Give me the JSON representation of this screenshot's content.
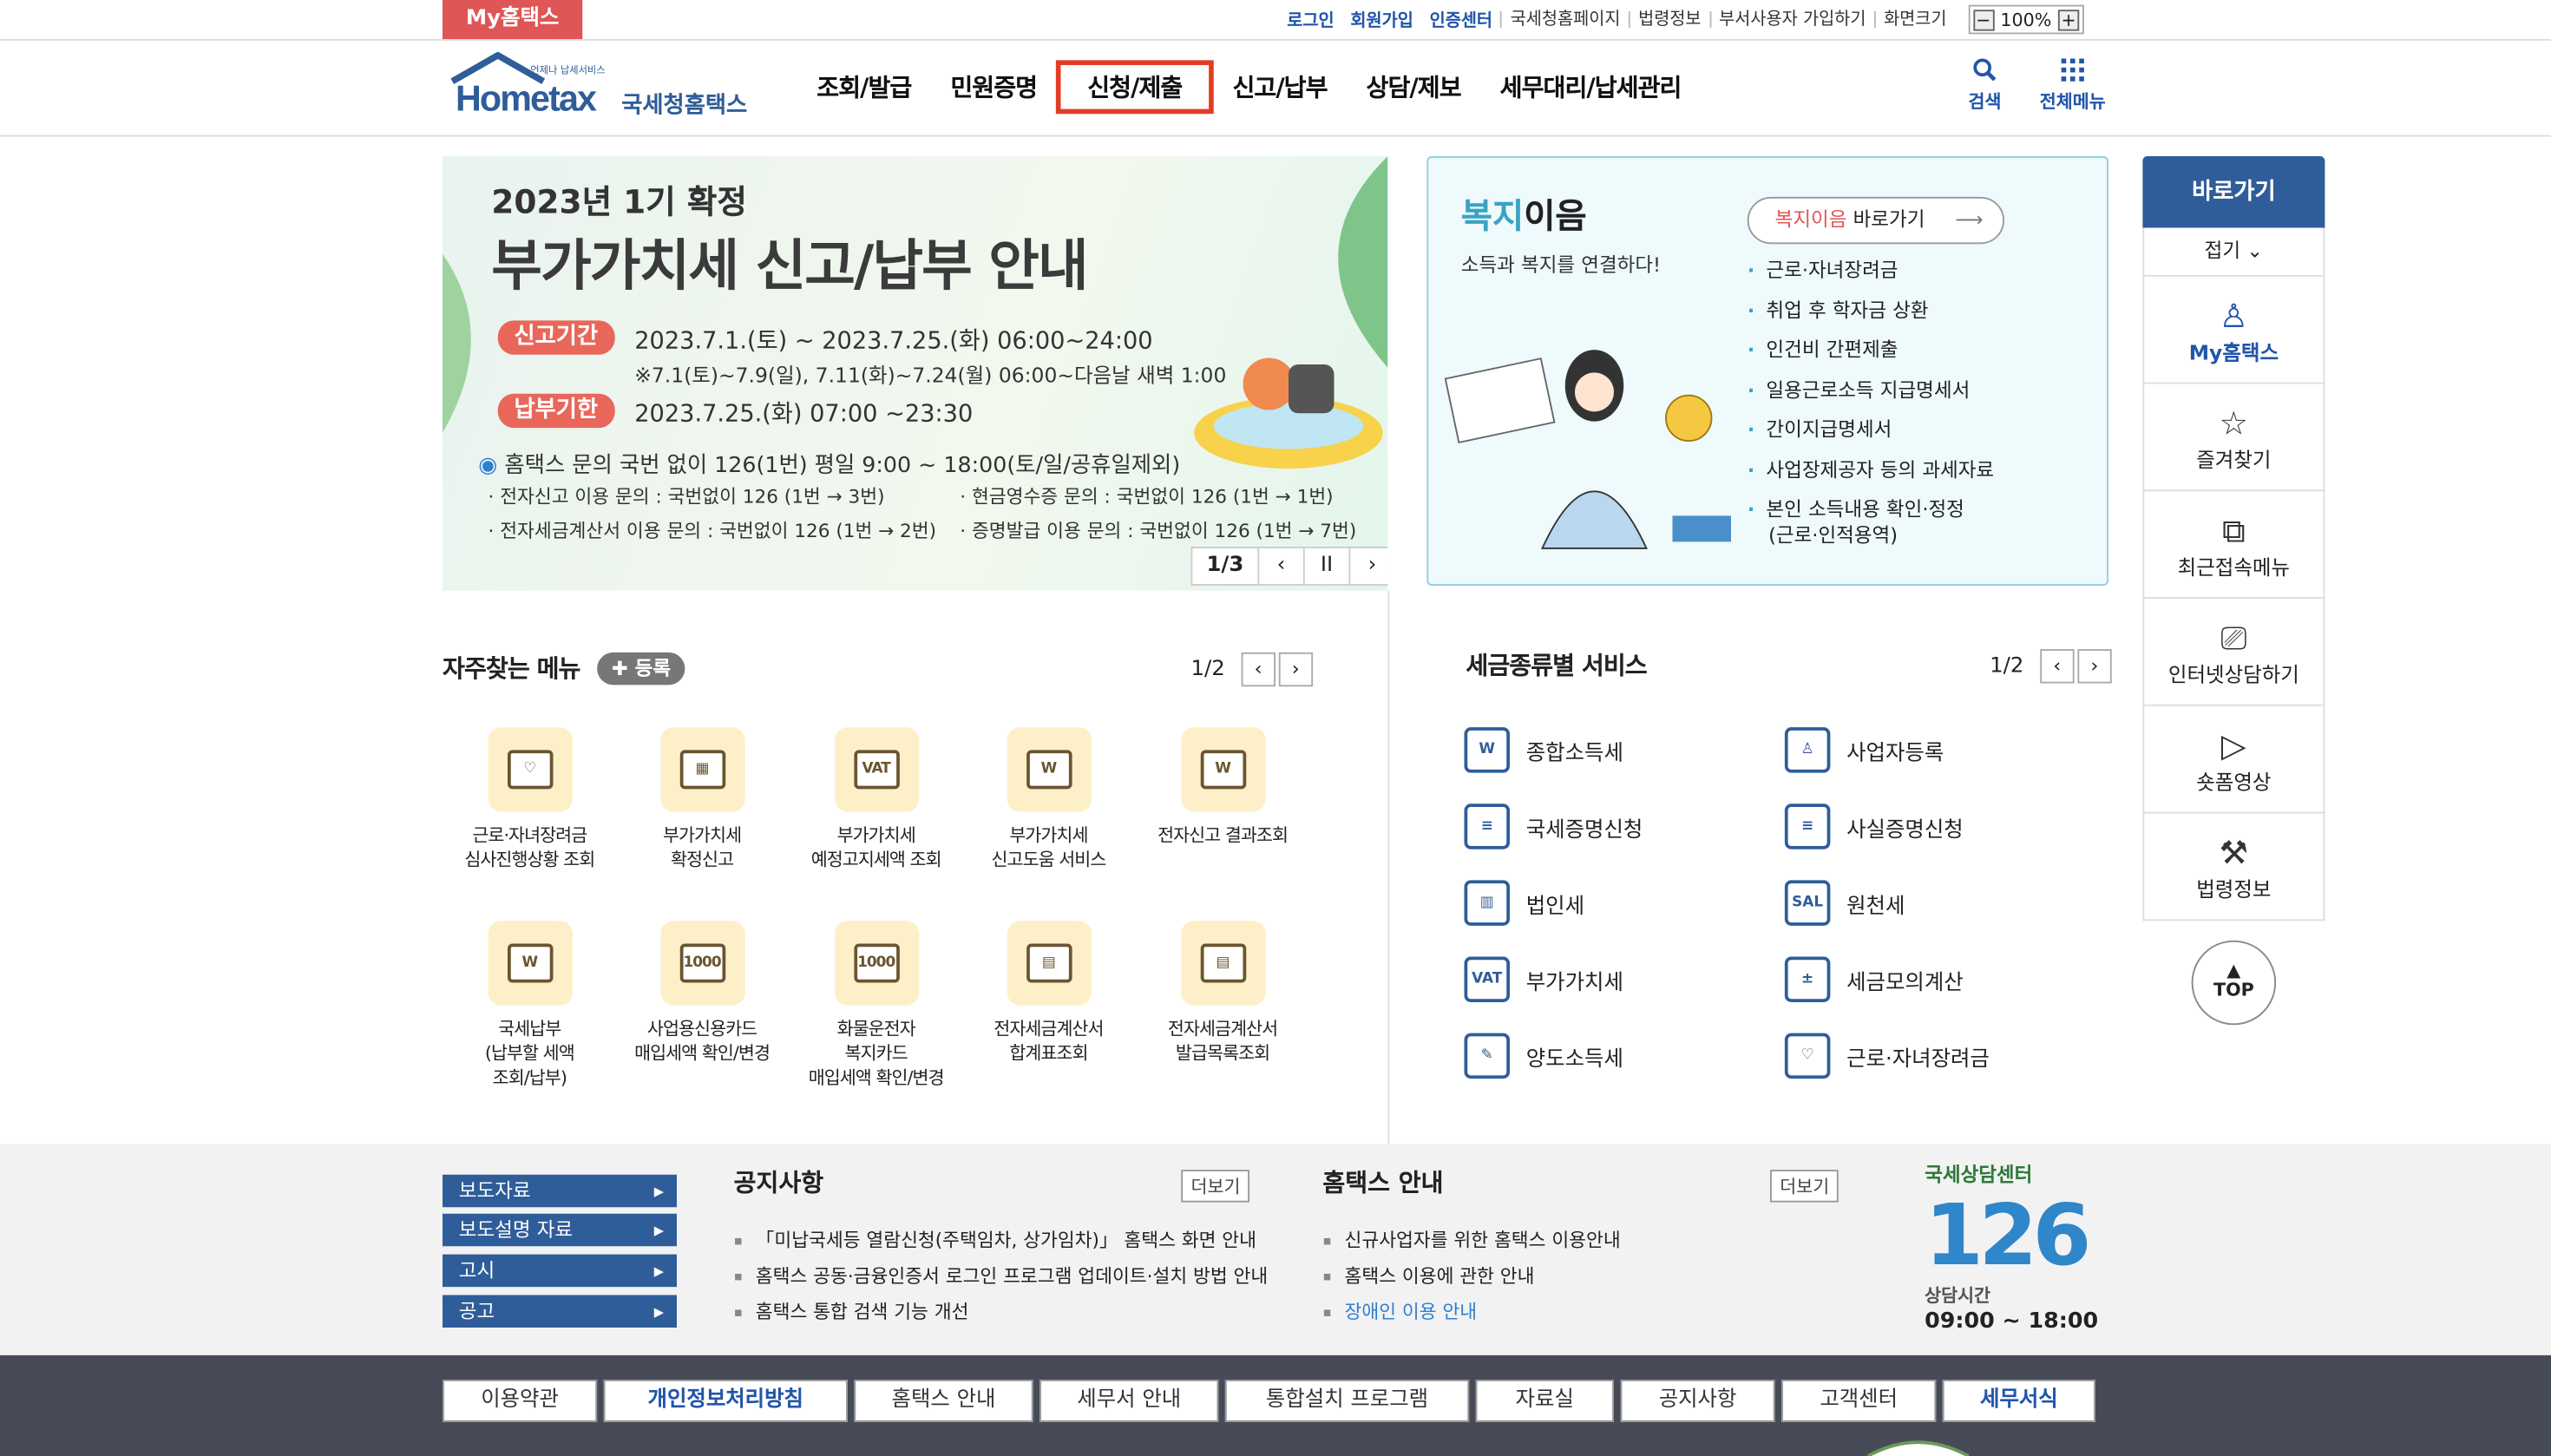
{
  "util": {
    "my_hometax": "My홈택스",
    "links_blue": [
      "로그인",
      "회원가입",
      "인증센터"
    ],
    "links": [
      "국세청홈페이지",
      "법령정보",
      "부서사용자 가입하기",
      "화면크기"
    ],
    "zoom": "100%",
    "zoom_minus": "−",
    "zoom_plus": "+"
  },
  "header": {
    "logo_small": "언제나 납세서비스",
    "logo_main": "Hometax",
    "logo_kor": "국세청홈택스",
    "nav": [
      "조회/발급",
      "민원증명",
      "신청/제출",
      "신고/납부",
      "상담/제보",
      "세무대리/납세관리"
    ],
    "search_label": "검색",
    "allmenu_label": "전체메뉴"
  },
  "banner": {
    "title1": "2023년 1기 확정",
    "title2": "부가가치세 신고/납부 안내",
    "pill1": "신고기간",
    "period1": "2023.7.1.(토) ~ 2023.7.25.(화) 06:00~24:00",
    "period1_note": "※7.1(토)~7.9(일), 7.11(화)~7.24(월) 06:00~다음날 새벽 1:00",
    "pill2": "납부기한",
    "period2": "2023.7.25.(화) 07:00 ~23:30",
    "inquiry": "홈택스 문의 국번 없이 126(1번) 평일 9:00 ~ 18:00(토/일/공휴일제외)",
    "sub1": "· 전자신고 이용 문의 : 국번없이 126 (1번 → 3번)",
    "sub2": "· 현금영수증 문의 : 국번없이 126 (1번 → 1번)",
    "sub3": "· 전자세금계산서 이용 문의 : 국번없이 126 (1번 → 2번)",
    "sub4": "· 증명발급 이용 문의 : 국번없이 126 (1번 → 7번)",
    "page": "1/3",
    "prev": "‹",
    "pause": "II",
    "next": "›"
  },
  "welfare": {
    "title_a": "복지",
    "title_b": "이음",
    "subtitle": "소득과 복지를 연결하다!",
    "btn_a": "복지이음",
    "btn_b": " 바로가기",
    "items": [
      "근로·자녀장려금",
      "취업 후 학자금 상환",
      "인건비 간편제출",
      "일용근로소득 지급명세서",
      "간이지급명세서",
      "사업장제공자 등의 과세자료",
      "본인 소득내용 확인·정정",
      "(근로·인적용역)"
    ]
  },
  "side": {
    "title": "바로가기",
    "fold": "접기 ⌄",
    "items": [
      {
        "icon": "person-icon",
        "label": "My홈택스"
      },
      {
        "icon": "star-icon",
        "label": "즐겨찾기"
      },
      {
        "icon": "recent-icon",
        "label": "최근접속메뉴"
      },
      {
        "icon": "monitor-icon",
        "label": "인터넷상담하기"
      },
      {
        "icon": "play-icon",
        "label": "숏폼영상"
      },
      {
        "icon": "gavel-icon",
        "label": "법령정보"
      }
    ],
    "top": "TOP"
  },
  "freq": {
    "title": "자주찾는 메뉴",
    "add": "✚ 등록",
    "page": "1/2",
    "items": [
      [
        "근로·자녀장려금",
        "심사진행상황 조회"
      ],
      [
        "부가가치세",
        "확정신고"
      ],
      [
        "부가가치세",
        "예정고지세액 조회"
      ],
      [
        "부가가치세",
        "신고도움 서비스"
      ],
      [
        "전자신고 결과조회"
      ],
      [
        "국세납부",
        "(납부할 세액",
        "조회/납부)"
      ],
      [
        "사업용신용카드",
        "매입세액 확인/변경"
      ],
      [
        "화물운전자",
        "복지카드",
        "매입세액 확인/변경"
      ],
      [
        "전자세금계산서",
        "합계표조회"
      ],
      [
        "전자세금계산서",
        "발급목록조회"
      ]
    ],
    "icon_marks": [
      "♡",
      "▦",
      "VAT",
      "W",
      "W",
      "W",
      "1000",
      "1000",
      "▤",
      "▤"
    ]
  },
  "taxsvc": {
    "title": "세금종류별 서비스",
    "page": "1/2",
    "left": [
      "종합소득세",
      "국세증명신청",
      "법인세",
      "부가가치세",
      "양도소득세"
    ],
    "right": [
      "사업자등록",
      "사실증명신청",
      "원천세",
      "세금모의계산",
      "근로·자녀장려금"
    ],
    "left_marks": [
      "W",
      "≡",
      "▥",
      "VAT",
      "✎"
    ],
    "right_marks": [
      "♙",
      "≡",
      "SAL",
      "±",
      "♡"
    ]
  },
  "press": [
    "보도자료",
    "보도설명 자료",
    "고시",
    "공고"
  ],
  "notice": {
    "title": "공지사항",
    "more": "더보기",
    "items": [
      "「미납국세등 열람신청(주택임차, 상가임차)」 홈택스 화면 안내",
      "홈택스 공동·금융인증서 로그인 프로그램 업데이트·설치 방법 안내",
      "홈택스 통합 검색 기능 개선"
    ]
  },
  "guide": {
    "title": "홈택스 안내",
    "more": "더보기",
    "items": [
      "신규사업자를 위한 홈택스 이용안내",
      "홈택스 이용에 관한 안내",
      "장애인 이용 안내"
    ]
  },
  "center": {
    "caption": "국세상담센터",
    "number": "126",
    "hours_label": "상담시간",
    "hours": "09:00 ~ 18:00"
  },
  "bottom_nav": [
    "이용약관",
    "개인정보처리방침",
    "홈택스 안내",
    "세무서 안내",
    "통합설치 프로그램",
    "자료실",
    "공지사항",
    "고객센터",
    "세무서식"
  ],
  "colors": {
    "brand": "#2f5d99",
    "accent_red": "#e23c24",
    "welfare_teal": "#3aa3c3"
  }
}
